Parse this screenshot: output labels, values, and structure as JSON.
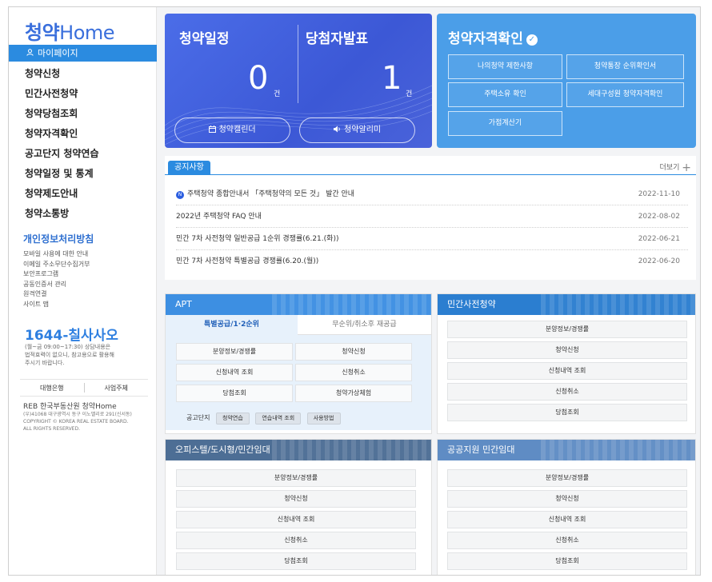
{
  "sidebar": {
    "logo_ko": "청약",
    "logo_en": "Home",
    "mypage": "마이페이지",
    "nav": [
      "청약신청",
      "민간사전청약",
      "청약당첨조회",
      "청약자격확인",
      "공고단지 청약연습",
      "청약일정 및 통계",
      "청약제도안내",
      "청약소통방"
    ],
    "policy_title": "개인정보처리방침",
    "policy_links": [
      "모바일 사용에 대한 안내",
      "이메일 주소무단수집거부",
      "보안프로그램",
      "공동인증서 관리",
      "원격연결",
      "사이트 맵"
    ],
    "phone": "1644-칠사사오",
    "hours_lines": [
      "(월~금 09:00~17:30) 상담내용은",
      "법적효력이 없으니, 참고용으로 활용해",
      "주시기 바랍니다."
    ],
    "bank": "대행은행",
    "operator": "사업주체",
    "reb_label": "REB 한국부동산원 청약Home",
    "address_lines": [
      "(우)41068 대구광역시 동구 이노밸리로 291(신서동)",
      "COPYRIGHT © KOREA REAL ESTATE BOARD.",
      "ALL RIGHTS RESERVED."
    ]
  },
  "schedule_card": {
    "left_title": "청약일정",
    "left_count": "0",
    "left_unit": "건",
    "right_title": "당첨자발표",
    "right_count": "1",
    "right_unit": "건",
    "calendar_btn": "청약캘린더",
    "alarm_btn": "청약알리미"
  },
  "qualify_card": {
    "title": "청약자격확인",
    "buttons": [
      "나의청약 제한사항",
      "청약통장 순위확인서",
      "주택소유 확인",
      "세대구성원 청약자격확인",
      "가점계산기"
    ]
  },
  "notice": {
    "tab": "공지사항",
    "more": "더보기",
    "rows": [
      {
        "title": "주택청약 종합안내서 「주택청약의 모든 것」 발간 안내",
        "date": "2022-11-10",
        "new": true
      },
      {
        "title": "2022년 주택청약 FAQ 안내",
        "date": "2022-08-02",
        "new": false
      },
      {
        "title": "민간 7차 사전청약 일반공급 1순위 경쟁률(6.21.(화))",
        "date": "2022-06-21",
        "new": false
      },
      {
        "title": "민간 7차 사전청약 특별공급 경쟁률(6.20.(월))",
        "date": "2022-06-20",
        "new": false
      }
    ]
  },
  "apt": {
    "title": "APT",
    "tab_active": "특별공급/1·2순위",
    "tab_inactive": "무순위/취소후 재공급",
    "buttons": [
      "분양정보/경쟁률",
      "청약신청",
      "신청내역 조회",
      "신청취소",
      "당첨조회",
      "청약가상체험"
    ],
    "bottom_label": "공고단지",
    "chips": [
      "청약연습",
      "연습내역 조회",
      "사용방법"
    ]
  },
  "private_pre": {
    "title": "민간사전청약",
    "buttons": [
      "분양정보/경쟁률",
      "청약신청",
      "신청내역 조회",
      "신청취소",
      "당첨조회"
    ]
  },
  "officetel": {
    "title": "오피스텔/도시형/민간임대",
    "buttons": [
      "분양정보/경쟁률",
      "청약신청",
      "신청내역 조회",
      "신청취소",
      "당첨조회"
    ]
  },
  "public_rent": {
    "title": "공공지원 민간임대",
    "buttons": [
      "분양정보/경쟁률",
      "청약신청",
      "신청내역 조회",
      "신청취소",
      "당첨조회"
    ]
  },
  "colors": {
    "brand_blue": "#2b8be0",
    "schedule_card": "#4564e0",
    "qualify_card": "#4b9ee8",
    "apt_head": "#3d8fe2",
    "private_head": "#2b7ed0",
    "officetel_head": "#4d6e95",
    "public_head": "#5f8cc4"
  }
}
